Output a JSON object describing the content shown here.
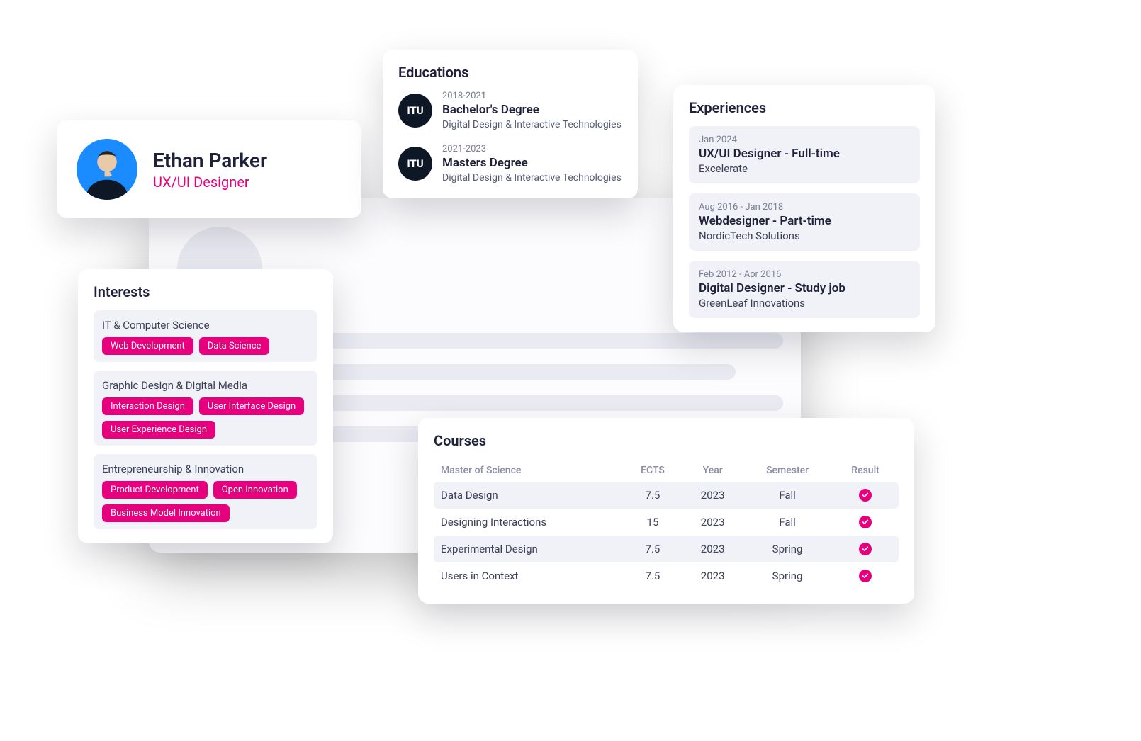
{
  "profile": {
    "name": "Ethan Parker",
    "role": "UX/UI Designer"
  },
  "educations": {
    "title": "Educations",
    "items": [
      {
        "logo": "ITU",
        "dates": "2018-2021",
        "degree": "Bachelor's Degree",
        "field": "Digital Design & Interactive Technologies"
      },
      {
        "logo": "ITU",
        "dates": "2021-2023",
        "degree": "Masters Degree",
        "field": "Digital Design & Interactive Technologies"
      }
    ]
  },
  "experiences": {
    "title": "Experiences",
    "items": [
      {
        "dates": "Jan 2024",
        "title": "UX/UI Designer - Full-time",
        "company": "Excelerate"
      },
      {
        "dates": "Aug 2016 - Jan 2018",
        "title": "Webdesigner - Part-time",
        "company": "NordicTech Solutions"
      },
      {
        "dates": "Feb 2012 - Apr 2016",
        "title": "Digital Designer - Study job",
        "company": "GreenLeaf Innovations"
      }
    ]
  },
  "interests": {
    "title": "Interests",
    "groups": [
      {
        "title": "IT & Computer Science",
        "tags": [
          "Web Development",
          "Data Science"
        ]
      },
      {
        "title": "Graphic Design & Digital Media",
        "tags": [
          "Interaction Design",
          "User Interface Design",
          "User Experience Design"
        ]
      },
      {
        "title": "Entrepreneurship & Innovation",
        "tags": [
          "Product Development",
          "Open Innovation",
          "Business Model Innovation"
        ]
      }
    ]
  },
  "courses": {
    "title": "Courses",
    "columns": {
      "c0": "Master of Science",
      "c1": "ECTS",
      "c2": "Year",
      "c3": "Semester",
      "c4": "Result"
    },
    "rows": [
      {
        "name": "Data Design",
        "ects": "7.5",
        "year": "2023",
        "semester": "Fall",
        "result": "pass"
      },
      {
        "name": "Designing Interactions",
        "ects": "15",
        "year": "2023",
        "semester": "Fall",
        "result": "pass"
      },
      {
        "name": "Experimental Design",
        "ects": "7.5",
        "year": "2023",
        "semester": "Spring",
        "result": "pass"
      },
      {
        "name": "Users in Context",
        "ects": "7.5",
        "year": "2023",
        "semester": "Spring",
        "result": "pass"
      }
    ]
  }
}
